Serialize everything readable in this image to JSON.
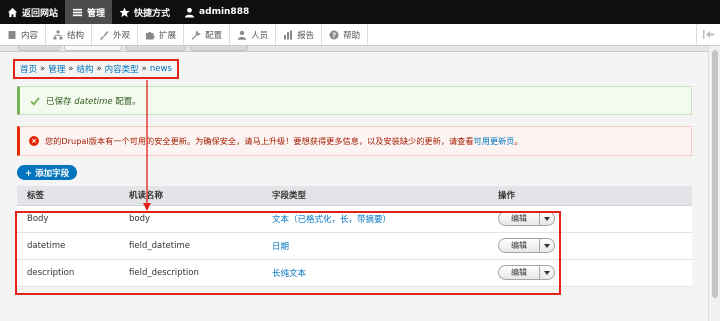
{
  "toolbar": {
    "back_label": "返回网站",
    "manage_label": "管理",
    "shortcuts_label": "快捷方式",
    "user_label": "admin888"
  },
  "tray": {
    "items": [
      "内容",
      "结构",
      "外观",
      "扩展",
      "配置",
      "人员",
      "报告",
      "帮助"
    ]
  },
  "breadcrumb": {
    "items": [
      "首页",
      "管理",
      "结构",
      "内容类型"
    ],
    "current": "news",
    "separator": "»"
  },
  "status_message": {
    "prefix": "已保存",
    "field": "datetime",
    "suffix": "配置。"
  },
  "error_message": {
    "text": "您的Drupal版本有一个可用的安全更新。为确保安全，请马上升级！要想获得更多信息，以及安装缺少的更新，请查看",
    "link": "可用更新页",
    "end": "。"
  },
  "add_field_button": "+ 添加字段",
  "table": {
    "headers": [
      "标签",
      "机读名称",
      "字段类型",
      "操作"
    ],
    "rows": [
      {
        "label": "Body",
        "machine_name": "body",
        "field_type": "文本（已格式化，长，带摘要）",
        "op": "编辑"
      },
      {
        "label": "datetime",
        "machine_name": "field_datetime",
        "field_type": "日期",
        "op": "编辑"
      },
      {
        "label": "description",
        "machine_name": "field_description",
        "field_type": "长纯文本",
        "op": "编辑"
      }
    ]
  },
  "colors": {
    "toolbar_bg": "#0f0f0f",
    "link": "#0074bd",
    "annotation_red": "#e2231a",
    "success_border": "#77b259",
    "error_border": "#e62600"
  }
}
